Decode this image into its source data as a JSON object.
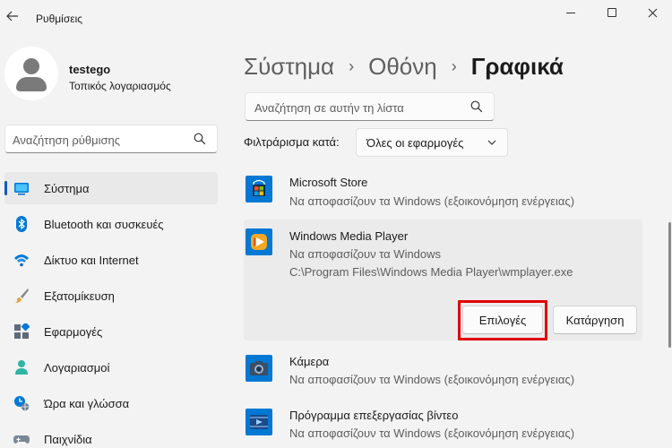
{
  "window": {
    "title": "Ρυθμίσεις"
  },
  "user": {
    "name": "testego",
    "account_type": "Τοπικός λογαριασμός"
  },
  "side_search": {
    "placeholder": "Αναζήτηση ρύθμισης"
  },
  "nav": {
    "items": [
      {
        "label": "Σύστημα",
        "icon": "system-icon",
        "selected": true
      },
      {
        "label": "Bluetooth και συσκευές",
        "icon": "bluetooth-icon"
      },
      {
        "label": "Δίκτυο και Internet",
        "icon": "wifi-icon"
      },
      {
        "label": "Εξατομίκευση",
        "icon": "brush-icon"
      },
      {
        "label": "Εφαρμογές",
        "icon": "apps-icon"
      },
      {
        "label": "Λογαριασμοί",
        "icon": "account-icon"
      },
      {
        "label": "Ώρα και γλώσσα",
        "icon": "clock-globe-icon"
      },
      {
        "label": "Παιχνίδια",
        "icon": "gamepad-icon"
      }
    ]
  },
  "breadcrumb": {
    "items": [
      "Σύστημα",
      "Οθόνη",
      "Γραφικά"
    ],
    "separator": "›"
  },
  "list_search": {
    "placeholder": "Αναζήτηση σε αυτήν τη λίστα"
  },
  "filter": {
    "label": "Φιλτράρισμα κατά:",
    "selected": "Όλες οι εφαρμογές"
  },
  "apps": [
    {
      "name": "Microsoft Store",
      "status": "Να αποφασίζουν τα Windows (εξοικονόμηση ενέργειας)"
    },
    {
      "name": "Windows Media Player",
      "status": "Να αποφασίζουν τα Windows",
      "path": "C:\\Program Files\\Windows Media Player\\wmplayer.exe",
      "expanded": true
    },
    {
      "name": "Κάμερα",
      "status": "Να αποφασίζουν τα Windows (εξοικονόμηση ενέργειας)"
    },
    {
      "name": "Πρόγραμμα επεξεργασίας βίντεο",
      "status": "Να αποφασίζουν τα Windows (εξοικονόμηση ενέργειας)"
    }
  ],
  "buttons": {
    "options": "Επιλογές",
    "remove": "Κατάργηση"
  },
  "colors": {
    "accent": "#005fb8",
    "highlight": "#e00000"
  }
}
